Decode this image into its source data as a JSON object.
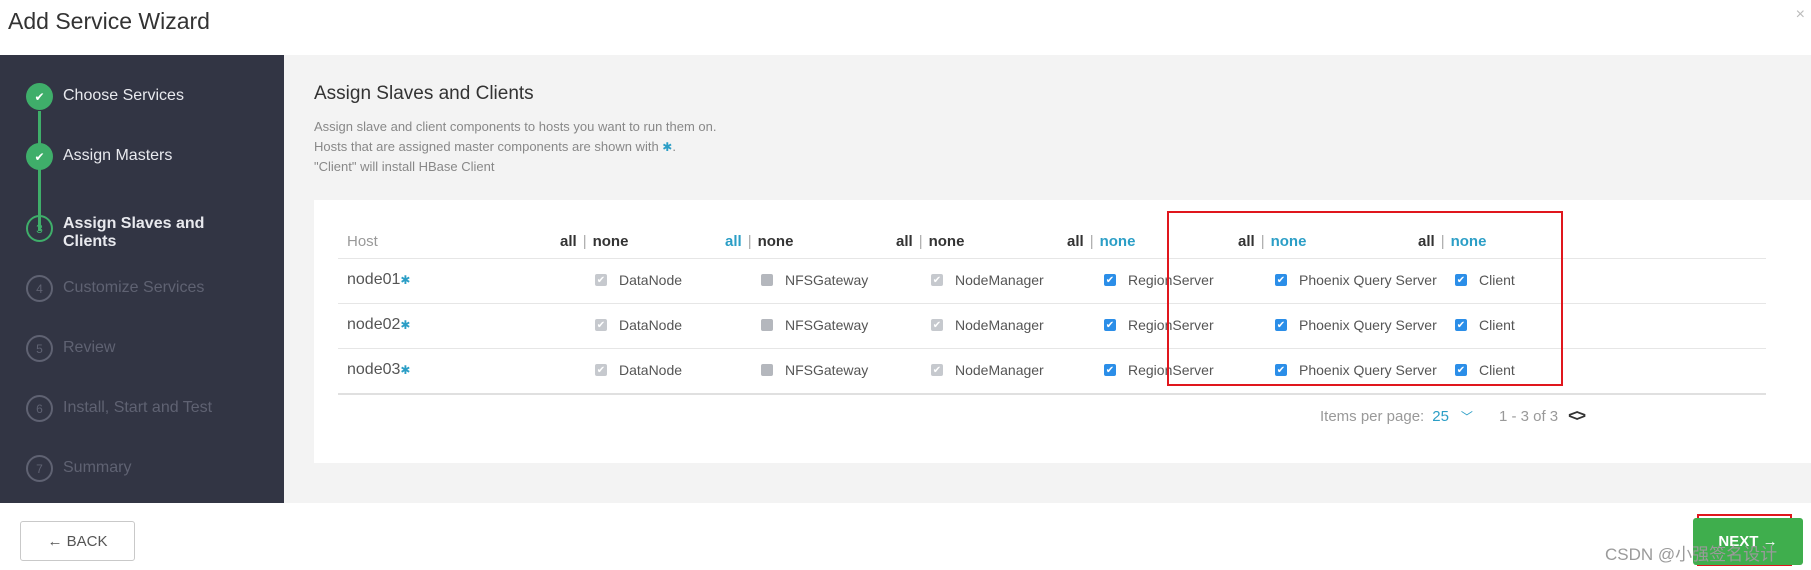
{
  "window": {
    "title": "Add Service Wizard",
    "close_glyph": "×"
  },
  "sidebar": {
    "steps": [
      {
        "num": "1",
        "label": "Choose Services",
        "state": "done"
      },
      {
        "num": "2",
        "label": "Assign Masters",
        "state": "done"
      },
      {
        "num": "3",
        "label": "Assign Slaves and Clients",
        "state": "current"
      },
      {
        "num": "4",
        "label": "Customize Services",
        "state": "todo"
      },
      {
        "num": "5",
        "label": "Review",
        "state": "todo"
      },
      {
        "num": "6",
        "label": "Install, Start and Test",
        "state": "todo"
      },
      {
        "num": "7",
        "label": "Summary",
        "state": "todo"
      }
    ]
  },
  "main": {
    "heading": "Assign Slaves and Clients",
    "desc_line1": "Assign slave and client components to hosts you want to run them on.",
    "desc_line2": "Hosts that are assigned master components are shown with",
    "desc_line2_end": ".",
    "desc_line3": "\"Client\" will install HBase Client",
    "asterisk": "✱"
  },
  "table": {
    "host_header": "Host",
    "all_label": "all",
    "none_label": "none",
    "separator": "|",
    "hosts": [
      "node01",
      "node02",
      "node03"
    ],
    "components": [
      "DataNode",
      "NFSGateway",
      "NodeManager",
      "RegionServer",
      "Phoenix Query Server",
      "Client"
    ]
  },
  "pager": {
    "items_label": "Items per page:",
    "per_page": "25",
    "range": "1 - 3 of 3"
  },
  "footer": {
    "back_label": "← BACK",
    "next_label": "NEXT →",
    "watermark": "CSDN @小强签名设计"
  },
  "colors": {
    "accent_green": "#3fae6a",
    "link_blue": "#2b9ec6",
    "highlight_red": "#e0161d"
  }
}
